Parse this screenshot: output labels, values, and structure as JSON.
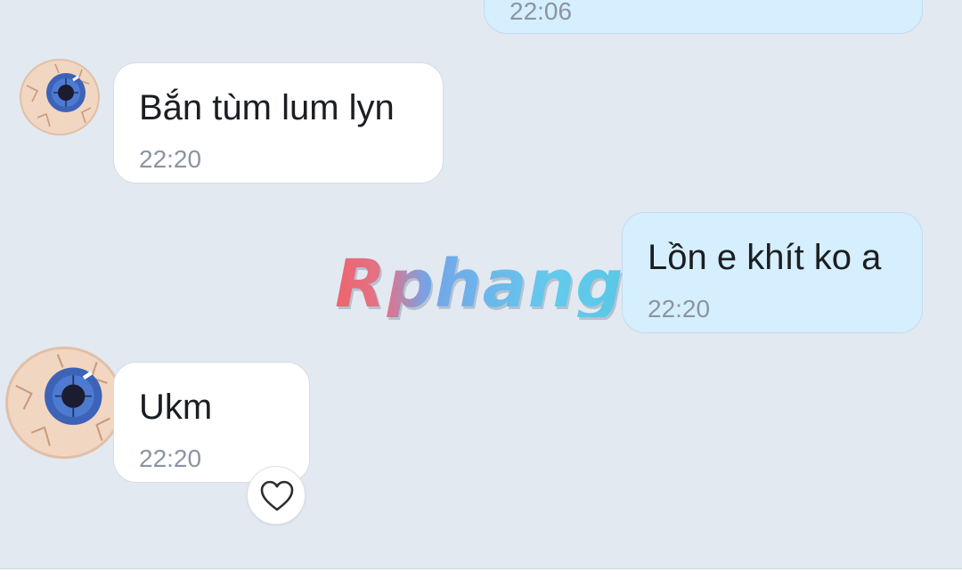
{
  "chat": {
    "messages": [
      {
        "direction": "outgoing",
        "text": "",
        "time": "22:06"
      },
      {
        "direction": "incoming",
        "text": "Bắn tùm lum lyn",
        "time": "22:20"
      },
      {
        "direction": "outgoing",
        "text": "Lồn e khít ko a",
        "time": "22:20"
      },
      {
        "direction": "incoming",
        "text": "Ukm",
        "time": "22:20",
        "reaction_icon": "heart-icon"
      }
    ]
  },
  "watermark": {
    "text": "Rphang"
  },
  "colors": {
    "background": "#e2e9f1",
    "incoming_bubble": "#ffffff",
    "outgoing_bubble": "#d6efff",
    "time_text": "#8b95a0"
  },
  "icons": {
    "avatar": "eyeball-avatar-icon",
    "reaction": "heart-icon"
  }
}
